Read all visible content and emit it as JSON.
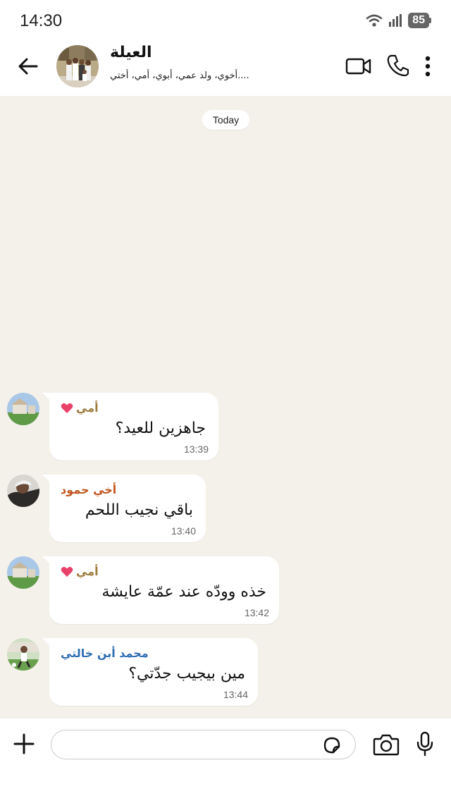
{
  "status": {
    "time": "14:30",
    "battery": "85",
    "icons": [
      "wifi-icon",
      "signal-icon",
      "battery-icon"
    ]
  },
  "header": {
    "title": "العيلة",
    "subtitle": "....أخوي، ولد عمي، أبوي، أمي، أختي",
    "icons": [
      "back-arrow-icon",
      "video-call-icon",
      "phone-icon",
      "more-vertical-icon"
    ]
  },
  "date_chip": "Today",
  "messages": [
    {
      "sender": "أمي",
      "heart": true,
      "sender_color": "#9b7a3b",
      "text": "جاهزين للعيد؟",
      "time": "13:39"
    },
    {
      "sender": "أخي حمود",
      "heart": false,
      "sender_color": "#c0541e",
      "text": "باقي نجيب اللحم",
      "time": "13:40"
    },
    {
      "sender": "أمي",
      "heart": true,
      "sender_color": "#9b7a3b",
      "text": "خذه وودّه عند عمّة عايشة",
      "time": "13:42"
    },
    {
      "sender": "محمد أبن خالتي",
      "heart": false,
      "sender_color": "#2f6db3",
      "text": "مين بيجيب جدّتي؟",
      "time": "13:44"
    }
  ],
  "composer": {
    "placeholder": "",
    "icons": [
      "plus-icon",
      "sticker-icon",
      "camera-icon",
      "mic-icon"
    ]
  },
  "colors": {
    "chat_background": "#f4f1ea",
    "header_background": "#ffffff",
    "heart": "#e8426b"
  }
}
